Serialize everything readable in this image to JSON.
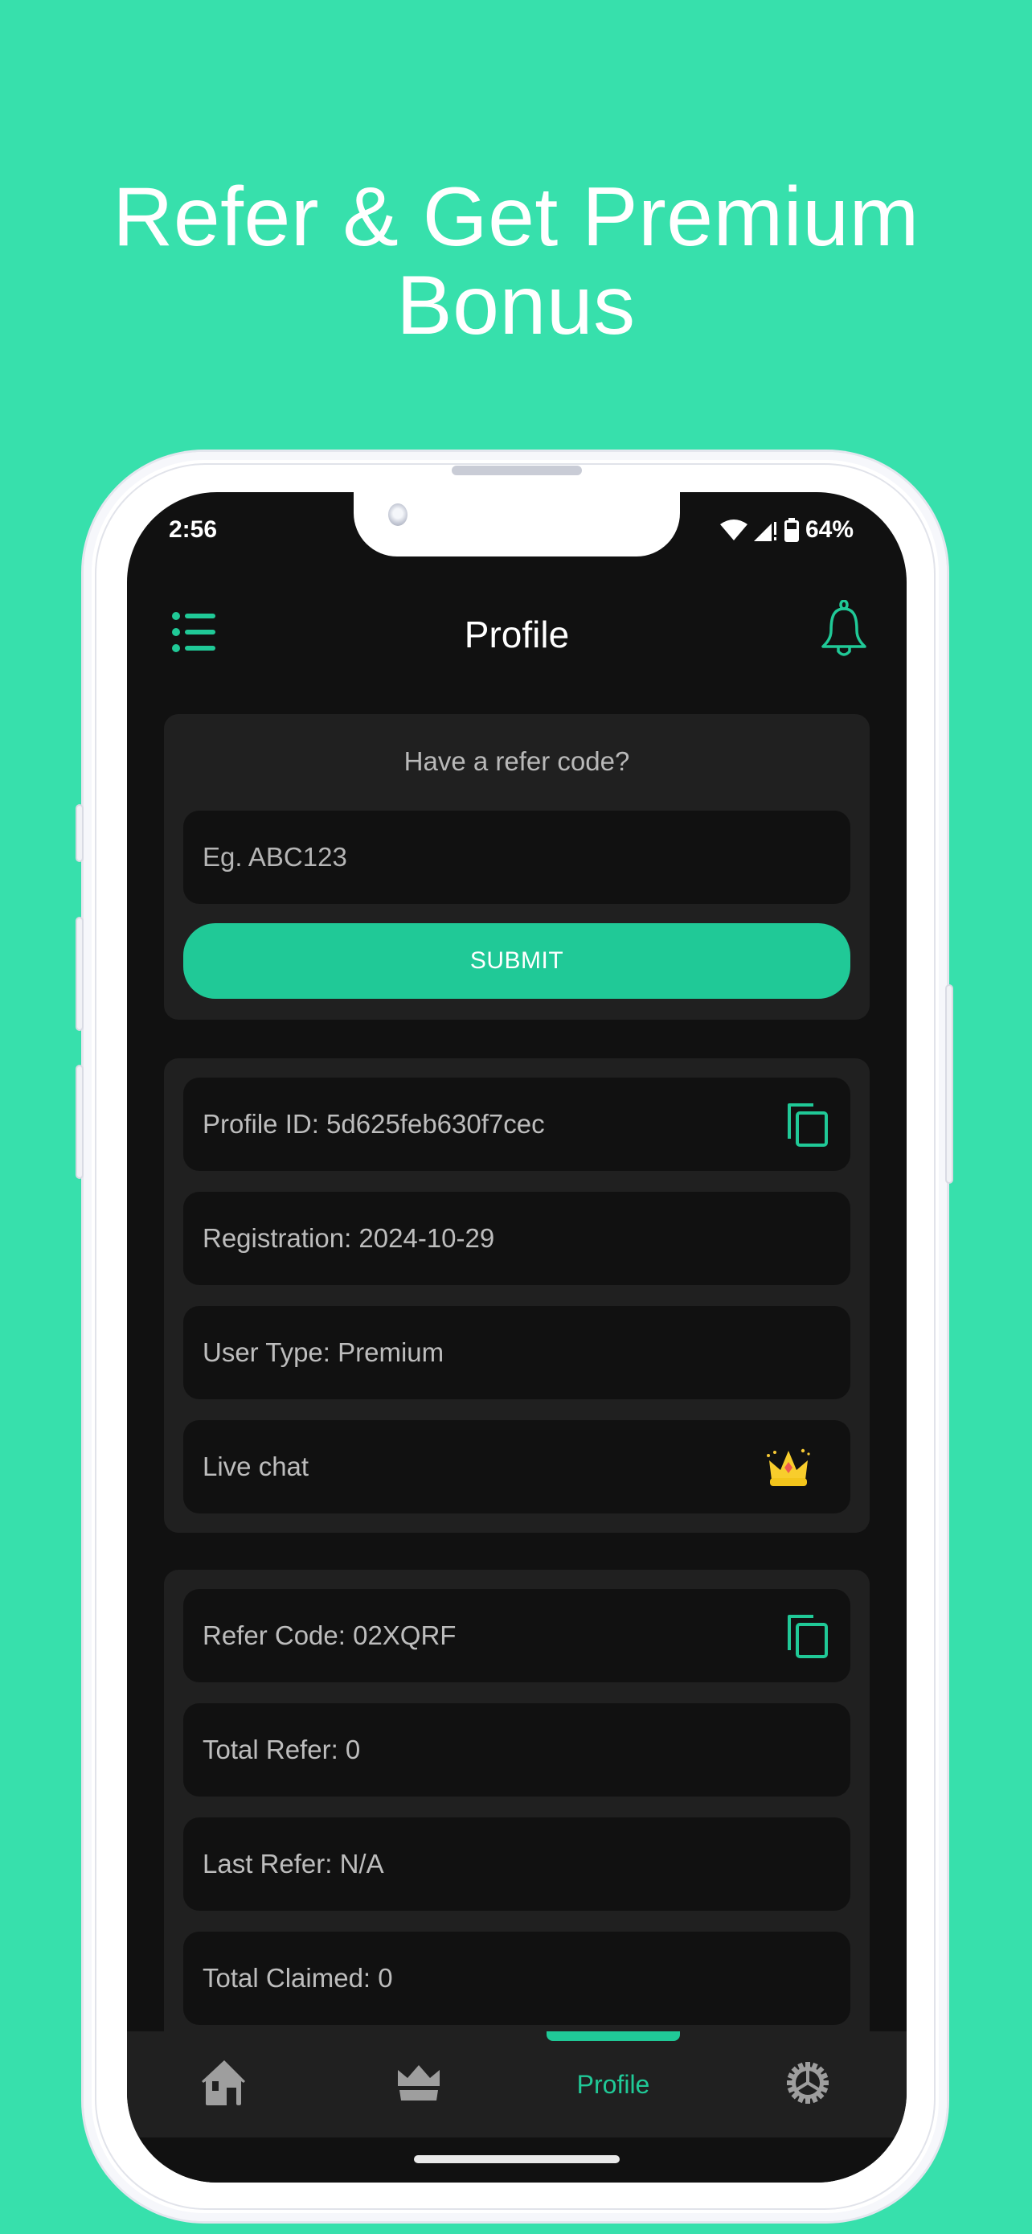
{
  "promo": {
    "headline_line1": "Refer & Get Premium",
    "headline_line2": "Bonus",
    "background_color": "#37e0ac"
  },
  "status_bar": {
    "time": "2:56",
    "battery_percent": "64%",
    "icons": [
      "wifi-icon",
      "cellular-signal-icon",
      "battery-icon"
    ]
  },
  "app_bar": {
    "title": "Profile",
    "left_icon": "menu-list-icon",
    "right_icon": "bell-icon"
  },
  "refer_card": {
    "heading": "Have a refer code?",
    "input_placeholder": "Eg. ABC123",
    "input_value": "",
    "submit_label": "SUBMIT"
  },
  "profile_card": {
    "rows": [
      {
        "text": "Profile ID: 5d625feb630f7cec",
        "action_icon": "copy-icon"
      },
      {
        "text": "Registration: 2024-10-29"
      },
      {
        "text": "User Type: Premium"
      },
      {
        "text": "Live chat",
        "action_icon": "crown-icon"
      }
    ]
  },
  "referral_card": {
    "rows": [
      {
        "text": "Refer Code: 02XQRF",
        "action_icon": "copy-icon"
      },
      {
        "text": "Total Refer: 0"
      },
      {
        "text": "Last Refer: N/A"
      },
      {
        "text": "Total Claimed: 0"
      }
    ]
  },
  "bottom_nav": {
    "items": [
      {
        "name": "home",
        "icon": "home-icon",
        "active": false
      },
      {
        "name": "premium",
        "icon": "crown-icon",
        "active": false
      },
      {
        "name": "profile",
        "label": "Profile",
        "active": true
      },
      {
        "name": "settings",
        "icon": "gear-icon",
        "active": false
      }
    ]
  },
  "colors": {
    "accent": "#20c997",
    "screen_bg": "#111111",
    "card_bg": "#202020",
    "text_secondary": "#bdbdbd"
  }
}
